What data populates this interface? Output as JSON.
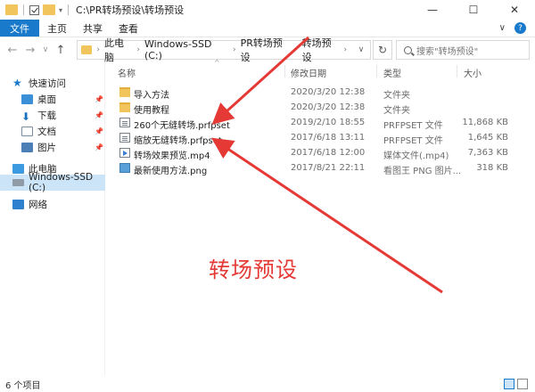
{
  "window": {
    "path_title": "C:\\PR转场预设\\转场预设",
    "minimize": "—",
    "maximize": "☐",
    "close": "✕"
  },
  "ribbon": {
    "tabs": [
      "文件",
      "主页",
      "共享",
      "查看"
    ],
    "expand": "∨",
    "help": "?"
  },
  "nav": {
    "back": "←",
    "forward": "→",
    "recent": "∨",
    "up": "↑",
    "breadcrumb": [
      "此电脑",
      "Windows-SSD (C:)",
      "PR转场预设",
      "转场预设"
    ],
    "refresh": "↻",
    "search_placeholder": "搜索\"转场预设\""
  },
  "sidebar": {
    "items": [
      {
        "label": "快速访问",
        "icon": "star-icon"
      },
      {
        "label": "桌面",
        "icon": "desktop-icon",
        "pinned": true
      },
      {
        "label": "下载",
        "icon": "download-icon",
        "pinned": true
      },
      {
        "label": "文档",
        "icon": "document-icon",
        "pinned": true
      },
      {
        "label": "图片",
        "icon": "picture-icon",
        "pinned": true
      },
      {
        "label": "此电脑",
        "icon": "computer-icon"
      },
      {
        "label": "Windows-SSD (C:)",
        "icon": "drive-icon",
        "selected": true
      },
      {
        "label": "网络",
        "icon": "network-icon"
      }
    ],
    "pin_glyph": "📌"
  },
  "columns": {
    "name": "名称",
    "date": "修改日期",
    "type": "类型",
    "size": "大小",
    "sort_caret": "^"
  },
  "files": [
    {
      "name": "导入方法",
      "date": "2020/3/20 12:38",
      "type": "文件夹",
      "size": "",
      "icon": "folder-icon"
    },
    {
      "name": "使用教程",
      "date": "2020/3/20 12:38",
      "type": "文件夹",
      "size": "",
      "icon": "folder-icon"
    },
    {
      "name": "260个无缝转场.prfpset",
      "date": "2019/2/10 18:55",
      "type": "PRFPSET 文件",
      "size": "11,868 KB",
      "icon": "prfpset-file-icon"
    },
    {
      "name": "缩放无缝转场.prfpset",
      "date": "2017/6/18 13:11",
      "type": "PRFPSET 文件",
      "size": "1,645 KB",
      "icon": "prfpset-file-icon"
    },
    {
      "name": "转场效果预览.mp4",
      "date": "2017/6/18 12:00",
      "type": "媒体文件(.mp4)",
      "size": "7,363 KB",
      "icon": "video-file-icon"
    },
    {
      "name": "最新使用方法.png",
      "date": "2017/8/21 22:11",
      "type": "看图王 PNG 图片...",
      "size": "318 KB",
      "icon": "image-file-icon"
    }
  ],
  "annotation": {
    "label": "转场预设",
    "color": "#e53935"
  },
  "status": {
    "count": "6 个项目"
  },
  "colors": {
    "accent": "#1979ca",
    "folder": "#f2c55c",
    "selection": "#cce4f7"
  }
}
